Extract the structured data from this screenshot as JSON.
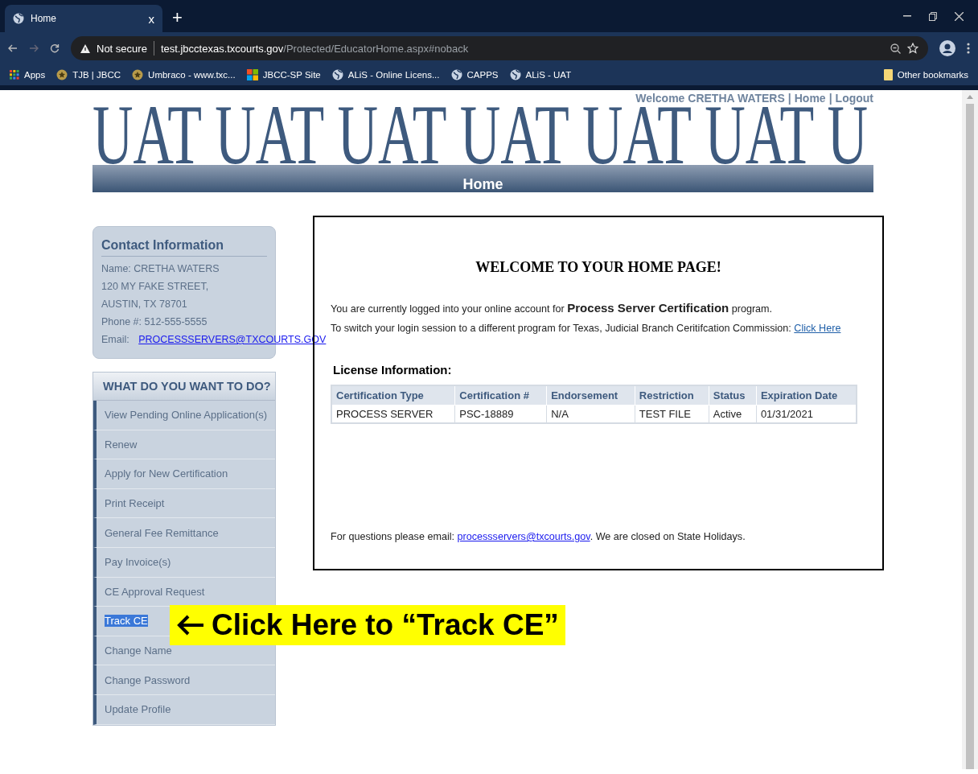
{
  "browser": {
    "tab": {
      "title": "Home",
      "close": "x",
      "new_tab": "+"
    },
    "address": {
      "security": "Not secure",
      "host": "test.jbcctexas.txcourts.gov",
      "path": "/Protected/EducatorHome.aspx#noback"
    },
    "bookmarks": [
      {
        "label": "Apps",
        "kind": "apps"
      },
      {
        "label": "TJB | JBCC",
        "kind": "seal"
      },
      {
        "label": "Umbraco - www.txc...",
        "kind": "seal"
      },
      {
        "label": "JBCC-SP Site",
        "kind": "tiles"
      },
      {
        "label": "ALiS - Online Licens...",
        "kind": "globe"
      },
      {
        "label": "CAPPS",
        "kind": "globe"
      },
      {
        "label": "ALiS - UAT",
        "kind": "globe"
      }
    ],
    "other_bookmarks": "Other bookmarks"
  },
  "header": {
    "banner": "UAT UAT UAT UAT UAT UAT U",
    "separator": "|",
    "user_links": [
      {
        "label": "Welcome CRETHA WATERS"
      },
      {
        "label": "Home"
      },
      {
        "label": "Logout"
      }
    ],
    "nav_title": "Home"
  },
  "contact": {
    "title": "Contact Information",
    "lines": [
      "Name: CRETHA WATERS",
      "120 MY FAKE STREET,",
      "AUSTIN, TX  78701",
      "Phone #: 512-555-5555"
    ],
    "email_label": "Email:",
    "email": "PROCESSSERVERS@TXCOURTS.GOV"
  },
  "menu": {
    "title": "WHAT DO YOU WANT TO DO?",
    "items": [
      {
        "label": "View Pending Online Application(s)",
        "highlighted": false
      },
      {
        "label": "Renew",
        "highlighted": false
      },
      {
        "label": "Apply for New Certification",
        "highlighted": false
      },
      {
        "label": "Print Receipt",
        "highlighted": false
      },
      {
        "label": "General Fee Remittance",
        "highlighted": false
      },
      {
        "label": "Pay Invoice(s)",
        "highlighted": false
      },
      {
        "label": "CE Approval Request",
        "highlighted": false
      },
      {
        "label": "Track CE",
        "highlighted": true
      },
      {
        "label": "Change Name",
        "highlighted": false
      },
      {
        "label": "Change Password",
        "highlighted": false
      },
      {
        "label": "Update Profile",
        "highlighted": false
      }
    ]
  },
  "callout": {
    "text": "Click Here to “Track CE”"
  },
  "main": {
    "heading": "WELCOME TO YOUR HOME PAGE!",
    "intro": "You are currently logged into your online account for **Process Server Certification** program.",
    "switch_text": "To switch your login session to a different program for Texas, Judicial Branch Ceritifcation Commission:",
    "switch_link": "Click Here",
    "license_title": "License Information:",
    "table": {
      "columns": [
        "Certification Type",
        "Certification #",
        "Endorsement",
        "Restriction",
        "Status",
        "Expiration Date"
      ],
      "rows": [
        [
          "PROCESS SERVER",
          "PSC-18889",
          "N/A",
          "TEST FILE",
          "Active",
          "01/31/2021"
        ]
      ]
    },
    "footer_before": "For questions please email:",
    "footer_link": "processservers@txcourts.gov",
    "footer_after": ". We are closed on State Holidays."
  }
}
